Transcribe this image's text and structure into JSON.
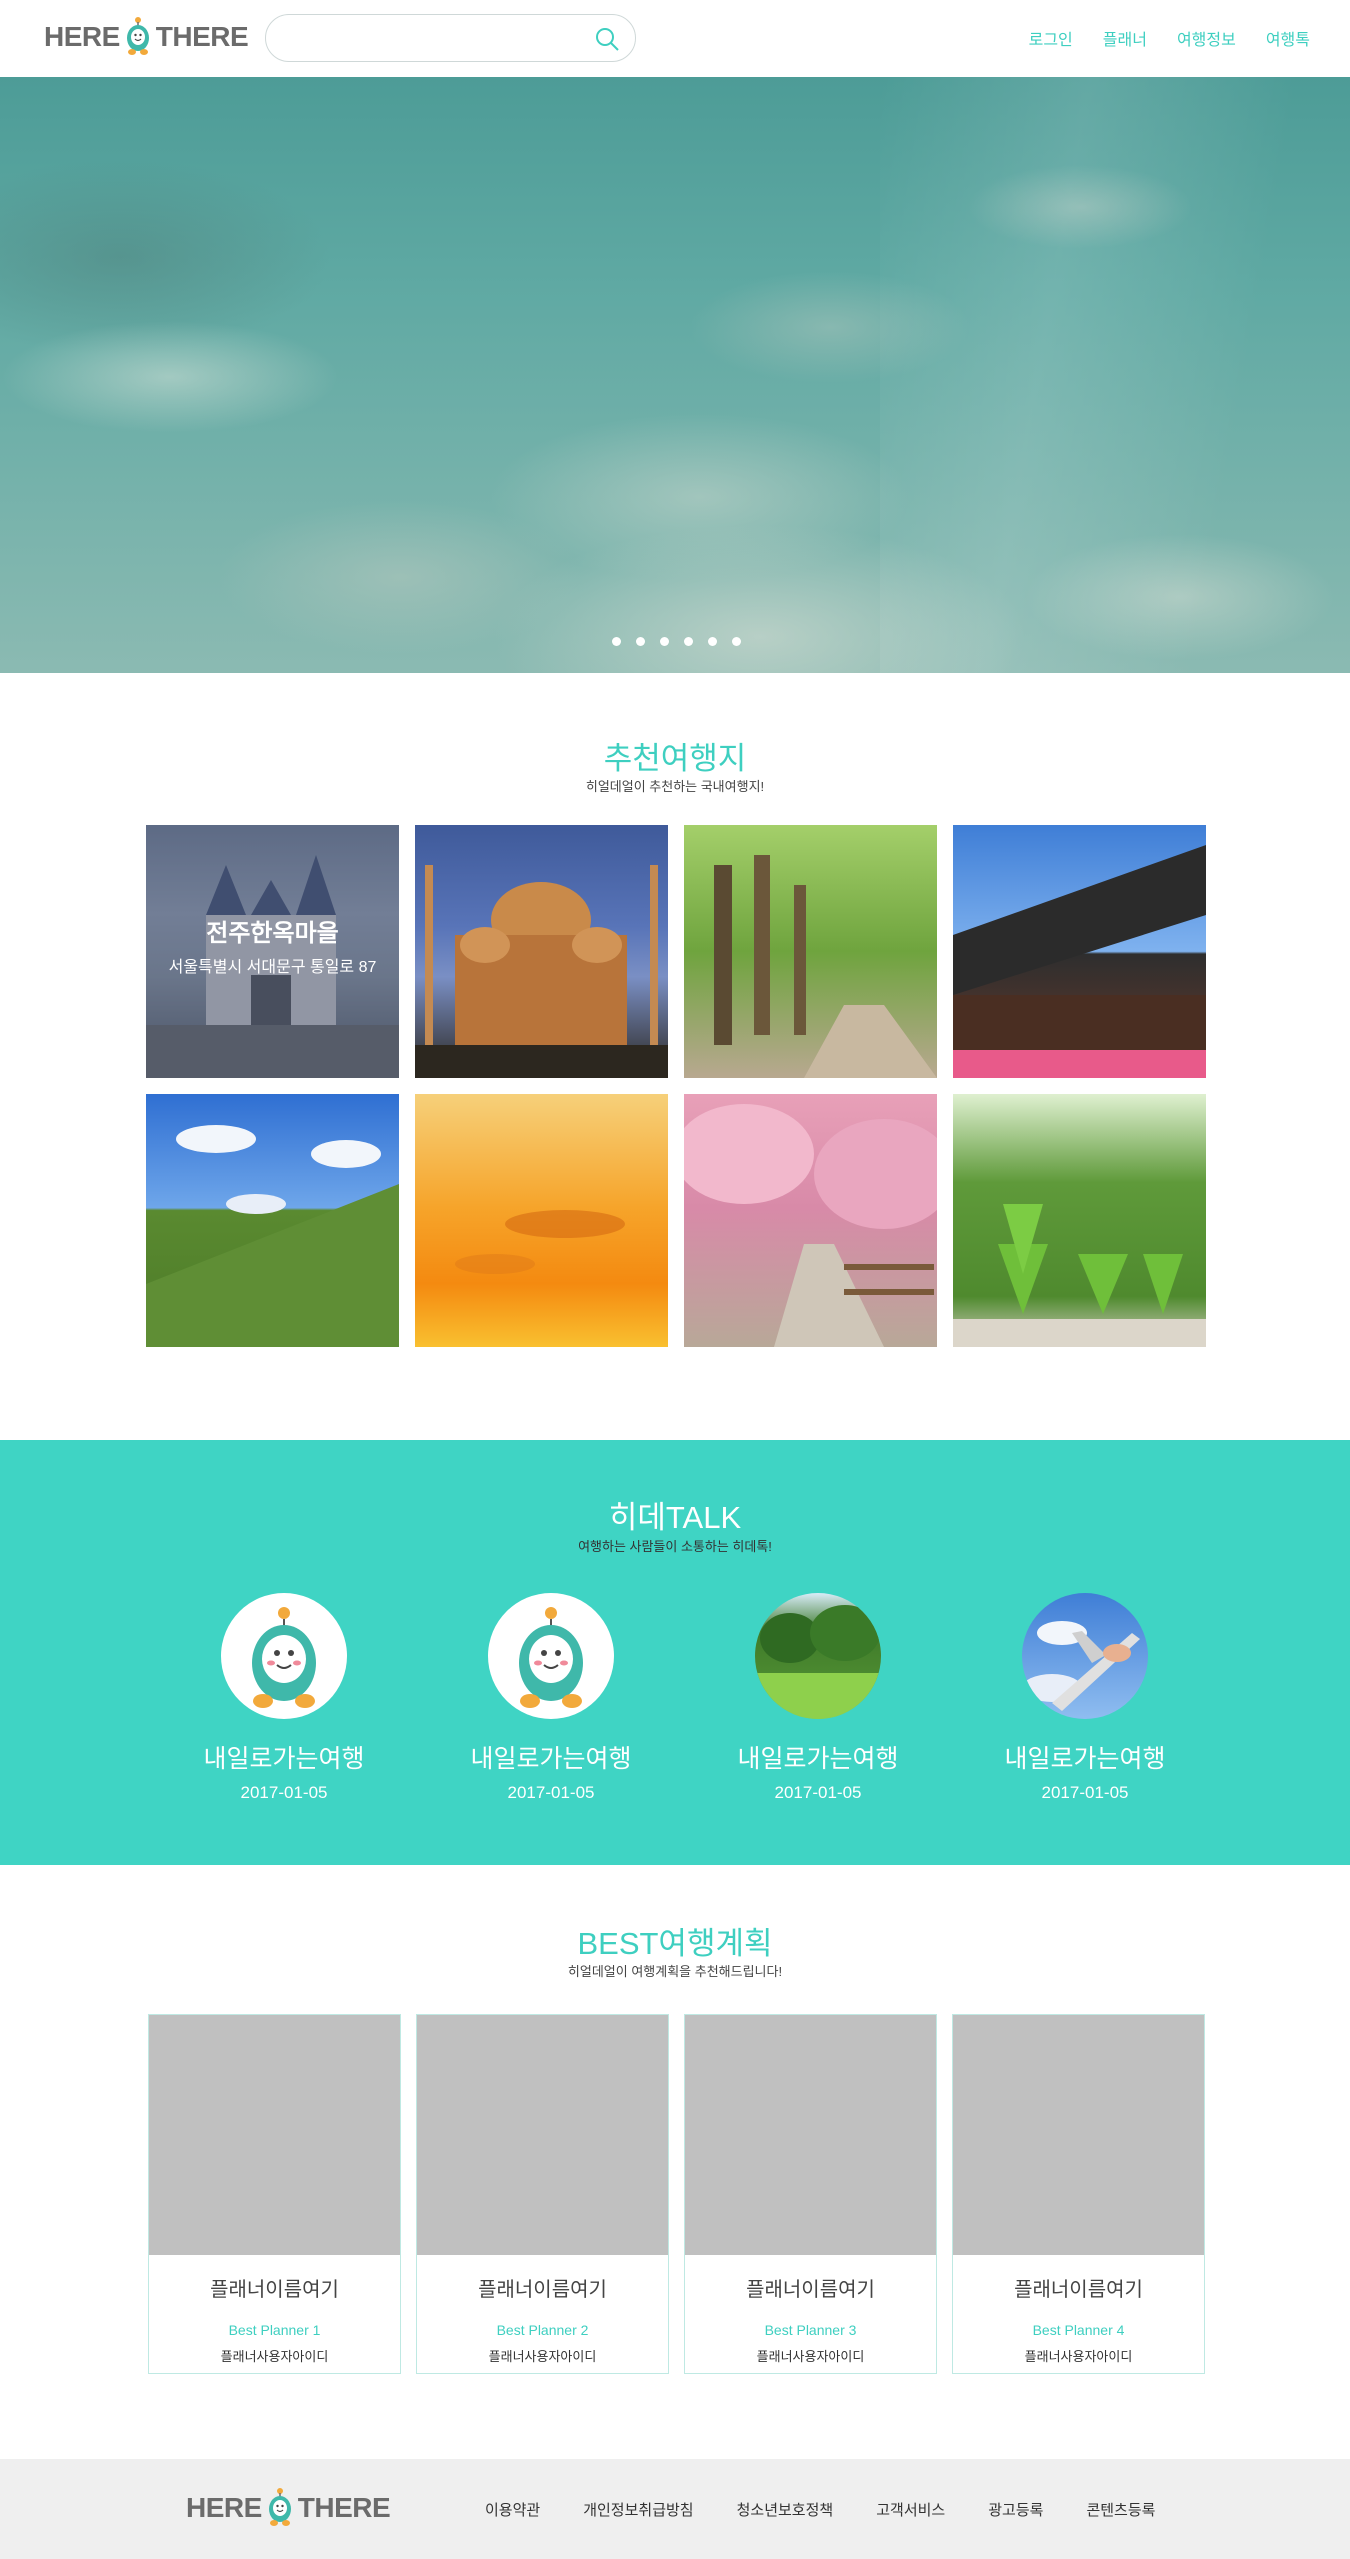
{
  "header": {
    "logo_left": "HERE",
    "logo_right": "THERE",
    "search": {
      "placeholder": "",
      "value": ""
    },
    "nav": [
      "로그인",
      "플래너",
      "여행정보",
      "여행톡"
    ]
  },
  "hero": {
    "slides": 6,
    "active_slide": 1
  },
  "recommended": {
    "title": "추천여행지",
    "subtitle": "히얼데얼이 추천하는 국내여행지!",
    "featured": {
      "name": "전주한옥마을",
      "address": "서울특별시 서대문구 통일로 87"
    }
  },
  "talk": {
    "title": "히데TALK",
    "subtitle": "여행하는 사람들이 소통하는 히데톡!",
    "items": [
      {
        "name": "내일로가는여행",
        "date": "2017-01-05",
        "avatar": "mascot-icon"
      },
      {
        "name": "내일로가는여행",
        "date": "2017-01-05",
        "avatar": "mascot-icon"
      },
      {
        "name": "내일로가는여행",
        "date": "2017-01-05",
        "avatar": "forest-photo"
      },
      {
        "name": "내일로가는여행",
        "date": "2017-01-05",
        "avatar": "airplane-photo"
      }
    ]
  },
  "best": {
    "title": "BEST여행계획",
    "subtitle": "히얼데얼이 여행계획을 추천해드립니다!",
    "cards": [
      {
        "name": "플래너이름여기",
        "rank": "Best Planner 1",
        "user": "플래너사용자아이디"
      },
      {
        "name": "플래너이름여기",
        "rank": "Best Planner 2",
        "user": "플래너사용자아이디"
      },
      {
        "name": "플래너이름여기",
        "rank": "Best Planner 3",
        "user": "플래너사용자아이디"
      },
      {
        "name": "플래너이름여기",
        "rank": "Best Planner 4",
        "user": "플래너사용자아이디"
      }
    ]
  },
  "footer": {
    "logo_left": "HERE",
    "logo_right": "THERE",
    "links": [
      "이용약관",
      "개인정보취급방침",
      "청소년보호정책",
      "고객서비스",
      "광고등록",
      "콘텐츠등록"
    ]
  },
  "colors": {
    "accent": "#3ecfc0",
    "talk_bg": "#3fd4c4",
    "footer_bg": "#efefef",
    "placeholder_gray": "#c0c0c0"
  }
}
